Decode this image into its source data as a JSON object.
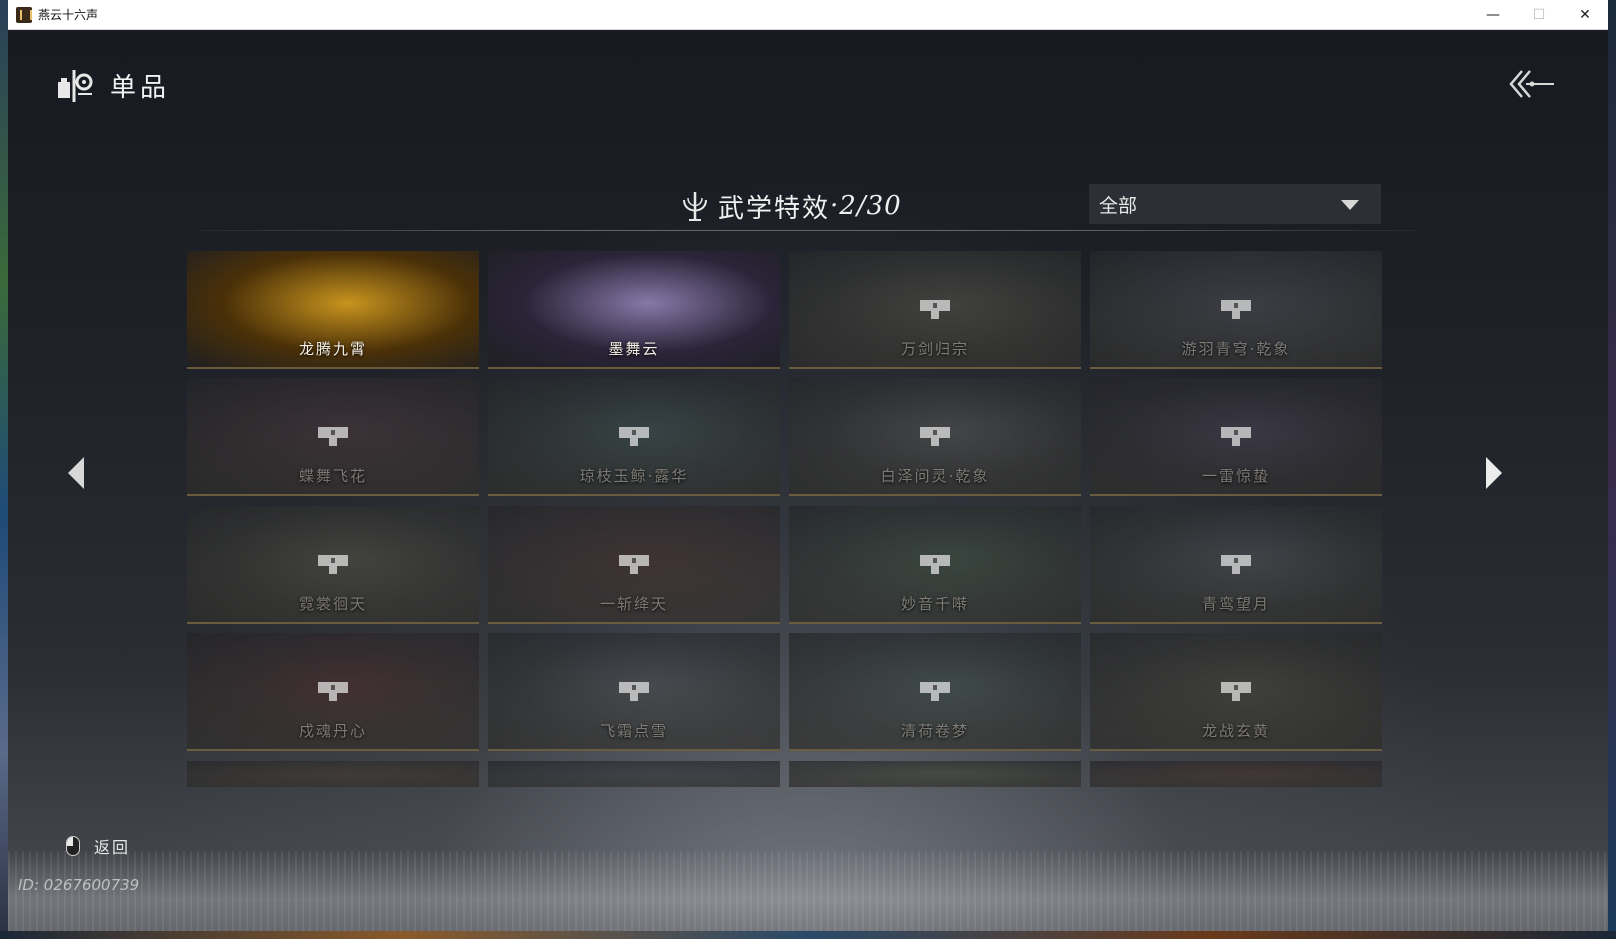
{
  "window": {
    "title": "燕云十六声",
    "controls": {
      "minimize": "—",
      "maximize": "☐",
      "close": "✕"
    }
  },
  "header": {
    "title": "单品"
  },
  "section": {
    "label": "武学特效",
    "count": "·2/30"
  },
  "filter": {
    "value": "全部"
  },
  "cards": [
    {
      "name": "龙腾九霄",
      "locked": false,
      "palette": [
        "#4a3008",
        "#c8941e"
      ]
    },
    {
      "name": "墨舞云",
      "locked": false,
      "palette": [
        "#2a2438",
        "#8878a8"
      ]
    },
    {
      "name": "万剑归宗",
      "locked": true,
      "palette": [
        "#3a3a34",
        "#6a6a52"
      ]
    },
    {
      "name": "游羽青穹·乾象",
      "locked": true,
      "palette": [
        "#3a3e48",
        "#5a6278"
      ]
    },
    {
      "name": "蝶舞飞花",
      "locked": true,
      "palette": [
        "#3a2a30",
        "#6a3a48"
      ]
    },
    {
      "name": "琼枝玉鲸·露华",
      "locked": true,
      "palette": [
        "#28383a",
        "#3a6a6a"
      ]
    },
    {
      "name": "白泽问灵·乾象",
      "locked": true,
      "palette": [
        "#343638",
        "#6a6c70"
      ]
    },
    {
      "name": "一雷惊蛰",
      "locked": true,
      "palette": [
        "#2e2a3a",
        "#5a4a7a"
      ]
    },
    {
      "name": "霓裳徊天",
      "locked": true,
      "palette": [
        "#3a3830",
        "#6a6648"
      ]
    },
    {
      "name": "一斩绛天",
      "locked": true,
      "palette": [
        "#3a2a2a",
        "#6a2e28"
      ]
    },
    {
      "name": "妙音千啭",
      "locked": true,
      "palette": [
        "#2a3a30",
        "#3e6a48"
      ]
    },
    {
      "name": "青鸾望月",
      "locked": true,
      "palette": [
        "#32363a",
        "#5a6a74"
      ]
    },
    {
      "name": "戍魂丹心",
      "locked": true,
      "palette": [
        "#3a2424",
        "#7a2424"
      ]
    },
    {
      "name": "飞霜点雪",
      "locked": true,
      "palette": [
        "#30343a",
        "#5a6470"
      ]
    },
    {
      "name": "清荷卷梦",
      "locked": true,
      "palette": [
        "#2a3634",
        "#3e6660"
      ]
    },
    {
      "name": "龙战玄黄",
      "locked": true,
      "palette": [
        "#34322a",
        "#5a5238"
      ]
    },
    {
      "name": "",
      "locked": true,
      "partial": true,
      "palette": [
        "#3a2e24",
        "#5a3e28"
      ]
    },
    {
      "name": "",
      "locked": true,
      "partial": true,
      "palette": [
        "#2a2e38",
        "#3a4258"
      ]
    },
    {
      "name": "",
      "locked": true,
      "partial": true,
      "palette": [
        "#2e3428",
        "#4a5a30"
      ]
    },
    {
      "name": "",
      "locked": true,
      "partial": true,
      "palette": [
        "#3a2824",
        "#6a3028"
      ]
    }
  ],
  "footer": {
    "return_label": "返回",
    "user_id": "ID: 0267600739"
  }
}
